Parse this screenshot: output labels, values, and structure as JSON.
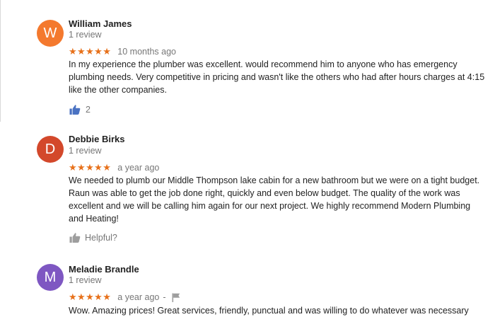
{
  "reviews": [
    {
      "initial": "W",
      "avatar_color": "#f4792e",
      "name": "William James",
      "review_count": "1 review",
      "stars": "★★★★★",
      "time": "10 months ago",
      "text": "In my experience the plumber was excellent. would recommend him to anyone who has emergency plumbing needs. Very competitive in pricing and wasn't like the others who had after hours charges at 4:15 like the other companies.",
      "likes": "2",
      "thumb_color": "#4a72c2"
    },
    {
      "initial": "D",
      "avatar_color": "#d3482b",
      "name": "Debbie Birks",
      "review_count": "1 review",
      "stars": "★★★★★",
      "time": "a year ago",
      "text": "We needed to plumb our Middle Thompson lake cabin for a new bathroom but we were on a tight budget.  Raun was able to get the job done right, quickly and even below budget.  The quality of the work was excellent and we will be calling him again for our next project.  We highly recommend Modern Plumbing and Heating!",
      "helpful": "Helpful?",
      "thumb_color": "#9e9e9e"
    },
    {
      "initial": "M",
      "avatar_color": "#7e57c2",
      "name": "Meladie Brandle",
      "review_count": "1 review",
      "stars": "★★★★★",
      "time": "a year ago",
      "separator": "-",
      "text": "Wow. Amazing prices! Great services, friendly, punctual and was willing to do whatever was necessary"
    }
  ],
  "colors": {
    "star": "#e7711b",
    "secondary_text": "#777777",
    "primary_text": "#222222"
  },
  "icons": [
    "thumbs-up-icon",
    "flag-icon"
  ]
}
